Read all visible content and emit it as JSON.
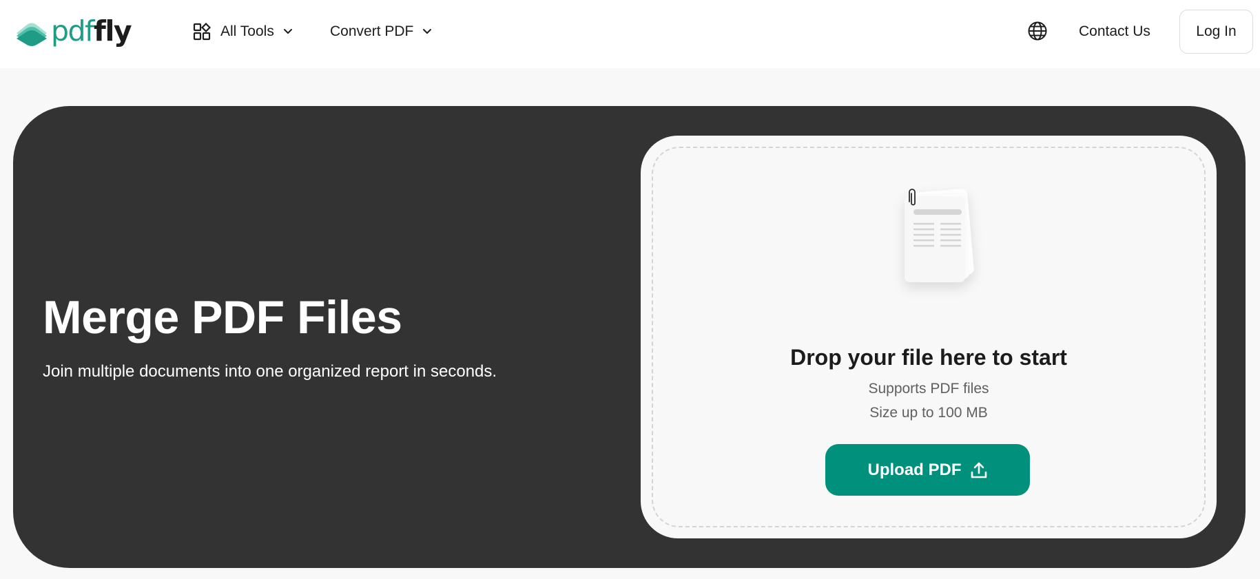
{
  "brand": {
    "logo_part1": "pdf",
    "logo_part2": "fly",
    "accent_color": "#1e9c86",
    "logo_icon": "stacked-leaf-logo-icon"
  },
  "header": {
    "nav": [
      {
        "label": "All Tools",
        "icon": "grid-shapes-icon",
        "has_dropdown": true
      },
      {
        "label": "Convert PDF",
        "has_dropdown": true
      }
    ],
    "language_icon": "globe-icon",
    "contact_label": "Contact Us",
    "login_label": "Log In"
  },
  "hero": {
    "title": "Merge PDF Files",
    "subtitle": "Join multiple documents into one organized report in seconds.",
    "background_color": "#333333"
  },
  "dropzone": {
    "illustration": "stacked-documents-with-paperclip-icon",
    "title": "Drop your file here to start",
    "supports": "Supports PDF files",
    "size_limit": "Size up to 100 MB",
    "upload_label": "Upload PDF",
    "upload_icon": "upload-arrow-icon",
    "button_color": "#00907c"
  }
}
